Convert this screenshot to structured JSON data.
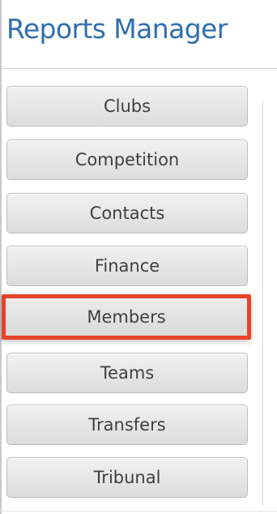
{
  "header": {
    "title": "Reports Manager"
  },
  "nav": {
    "items": [
      {
        "label": "Clubs"
      },
      {
        "label": "Competition"
      },
      {
        "label": "Contacts"
      },
      {
        "label": "Finance"
      },
      {
        "label": "Members",
        "highlighted": true
      },
      {
        "label": "Teams"
      },
      {
        "label": "Transfers"
      },
      {
        "label": "Tribunal"
      }
    ]
  },
  "colors": {
    "title": "#2f6fae",
    "button_text": "#3f3f3f",
    "highlight_border": "#e8432a"
  }
}
